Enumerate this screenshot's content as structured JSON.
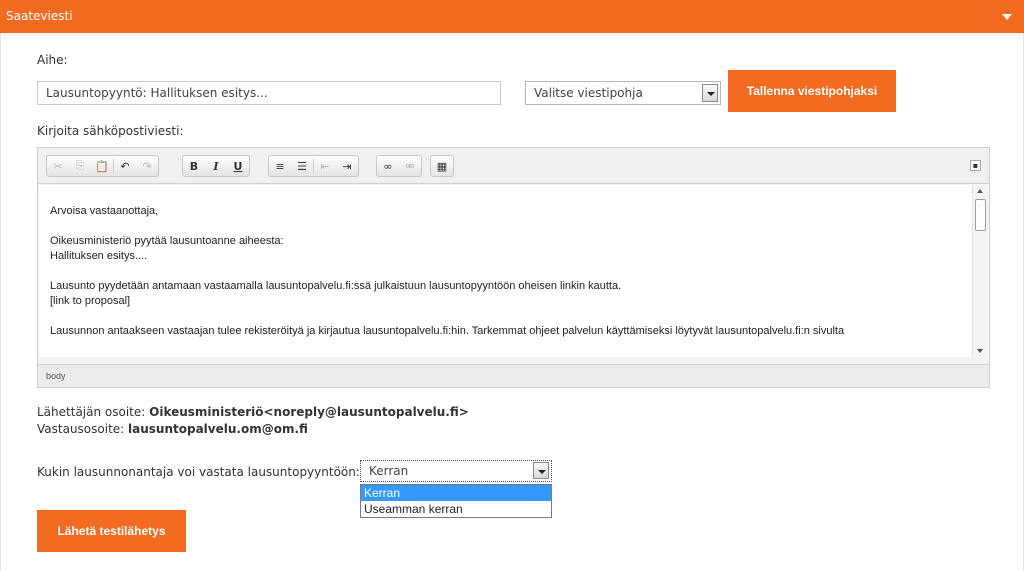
{
  "panel": {
    "title": "Saateviesti"
  },
  "subject": {
    "label": "Aihe:",
    "value": "Lausuntopyyntö: Hallituksen esitys..."
  },
  "template_select": {
    "selected": "Valitse viestipohja"
  },
  "save_template_button": "Tallenna viestipohjaksi",
  "email_label": "Kirjoita sähköpostiviesti:",
  "editor": {
    "content": [
      "Arvoisa vastaanottaja,",
      "",
      "Oikeusministeriö pyytää lausuntoanne aiheesta:",
      "Hallituksen esitys....",
      "",
      "Lausunto pyydetään antamaan vastaamalla lausuntopalvelu.fi:ssä julkaistuun lausuntopyyntöön oheisen linkin kautta.",
      "[link to proposal]",
      "",
      "Lausunnon antaakseen vastaajan tulee rekisteröityä ja kirjautua lausuntopalvelu.fi:hin. Tarkemmat ohjeet palvelun käyttämiseksi löytyvät lausuntopalvelu.fi:n sivulta"
    ],
    "status_path": "body"
  },
  "sender": {
    "label": "Lähettäjän osoite: ",
    "value": "Oikeusministeriö<noreply@lausuntopalvelu.fi>"
  },
  "reply": {
    "label": "Vastausosoite: ",
    "value": "lausuntopalvelu.om@om.fi"
  },
  "response_limit": {
    "label": "Kukin lausunnonantaja voi vastata lausuntopyyntöön:",
    "selected": "Kerran",
    "options": [
      "Kerran",
      "Useamman kerran"
    ]
  },
  "test_send_button": "Lähetä testilähetys",
  "colors": {
    "accent": "#f26b21",
    "selection": "#3399ff"
  }
}
